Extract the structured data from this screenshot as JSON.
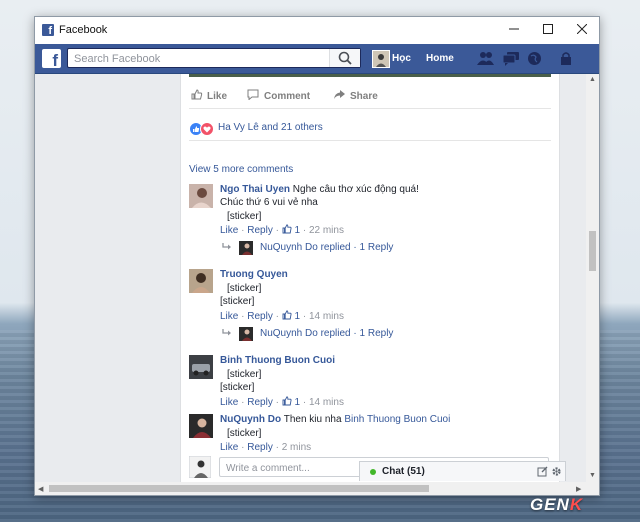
{
  "window": {
    "title": "Facebook",
    "minimize": "—",
    "maximize": "☐",
    "close": "✕"
  },
  "navbar": {
    "search_placeholder": "Search Facebook",
    "user_name": "Học",
    "home_label": "Home"
  },
  "post": {
    "actions": {
      "like": "Like",
      "comment": "Comment",
      "share": "Share"
    },
    "reactions_text": "Ha Vy Lê and 21 others",
    "view_more": "View 5 more comments"
  },
  "comments": [
    {
      "author": "Ngo Thai Uyen",
      "text": "Nghe câu thơ xúc động quá!",
      "text2": "Chúc thứ 6 vui vẻ nha",
      "sticker": "[sticker]",
      "like": "Like",
      "reply": "Reply",
      "likes": "1",
      "time": "22 mins",
      "reply_summary": {
        "author": "NuQuynh Do",
        "text": "replied",
        "count": "1 Reply"
      }
    },
    {
      "author": "Truong Quyen",
      "sticker": "[sticker]",
      "text2": "[sticker]",
      "like": "Like",
      "reply": "Reply",
      "likes": "1",
      "time": "14 mins",
      "reply_summary": {
        "author": "NuQuynh Do",
        "text": "replied",
        "count": "1 Reply"
      }
    },
    {
      "author": "Binh Thuong Buon Cuoi",
      "sticker": "[sticker]",
      "text2": "[sticker]",
      "like": "Like",
      "reply": "Reply",
      "likes": "1",
      "time": "14 mins"
    },
    {
      "author": "NuQuynh Do",
      "text": "Then kiu nha",
      "mention": "Binh Thuong Buon Cuoi",
      "sticker": "[sticker]",
      "like": "Like",
      "reply": "Reply",
      "time": "2 mins"
    }
  ],
  "composer": {
    "placeholder": "Write a comment..."
  },
  "chat": {
    "label": "Chat (51)"
  },
  "watermark": {
    "text_a": "GEN",
    "text_b": "K"
  },
  "colors": {
    "brand": "#3b5998",
    "link": "#365899",
    "online": "#42b72a"
  }
}
